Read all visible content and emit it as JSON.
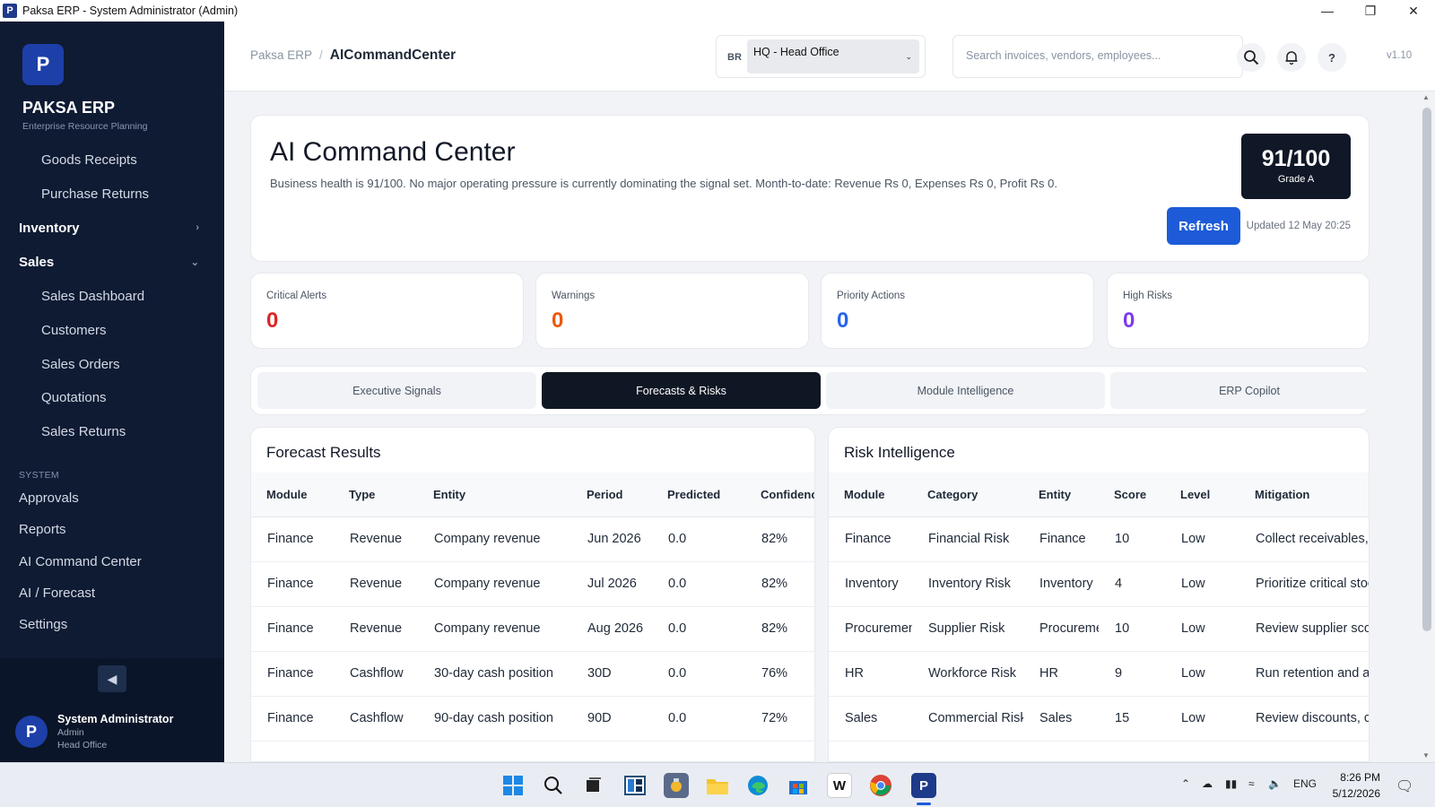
{
  "window": {
    "title": "Paksa ERP - System Administrator (Admin)",
    "app_icon": "P"
  },
  "sidebar": {
    "logo_letter": "P",
    "brand": "PAKSA ERP",
    "brand_sub": "Enterprise Resource Planning",
    "items": [
      {
        "label": "Goods Receipts",
        "kind": "sub"
      },
      {
        "label": "Purchase Returns",
        "kind": "sub"
      },
      {
        "label": "Inventory",
        "kind": "top",
        "chevron": "›"
      },
      {
        "label": "Sales",
        "kind": "top",
        "chevron": "⌄"
      },
      {
        "label": "Sales Dashboard",
        "kind": "sub"
      },
      {
        "label": "Customers",
        "kind": "sub"
      },
      {
        "label": "Sales Orders",
        "kind": "sub"
      },
      {
        "label": "Quotations",
        "kind": "sub"
      },
      {
        "label": "Sales Returns",
        "kind": "sub"
      }
    ],
    "section_label": "SYSTEM",
    "system_items": [
      "Approvals",
      "Reports",
      "AI Command Center",
      "AI / Forecast",
      "Settings"
    ],
    "collapse_icon": "◀",
    "user": {
      "avatar": "P",
      "name": "System Administrator",
      "role": "Admin",
      "branch": "Head Office"
    }
  },
  "header": {
    "breadcrumb_root": "Paksa ERP",
    "breadcrumb_sep": "/",
    "breadcrumb_current": "AICommandCenter",
    "branch_tag": "BR",
    "branch_value": "HQ - Head Office",
    "search_placeholder": "Search invoices, vendors, employees...",
    "help_label": "?",
    "version": "v1.10"
  },
  "hero": {
    "title": "AI Command Center",
    "description": "Business health is 91/100. No major operating pressure is currently dominating the signal set. Month-to-date: Revenue Rs 0, Expenses Rs 0, Profit Rs 0.",
    "score": "91/100",
    "grade": "Grade A",
    "refresh_label": "Refresh",
    "updated": "Updated 12 May 20:25"
  },
  "kpis": [
    {
      "label": "Critical Alerts",
      "value": "0",
      "color": "#dc2626"
    },
    {
      "label": "Warnings",
      "value": "0",
      "color": "#ea580c"
    },
    {
      "label": "Priority Actions",
      "value": "0",
      "color": "#2563eb"
    },
    {
      "label": "High Risks",
      "value": "0",
      "color": "#7c3aed"
    }
  ],
  "tabs": [
    {
      "label": "Executive Signals",
      "active": false
    },
    {
      "label": "Forecasts & Risks",
      "active": true
    },
    {
      "label": "Module Intelligence",
      "active": false
    },
    {
      "label": "ERP Copilot",
      "active": false
    }
  ],
  "forecast": {
    "title": "Forecast Results",
    "columns": [
      "Module",
      "Type",
      "Entity",
      "Period",
      "Predicted",
      "Confidence"
    ],
    "rows": [
      [
        "Finance",
        "Revenue",
        "Company revenue",
        "Jun 2026",
        "0.0",
        "82%"
      ],
      [
        "Finance",
        "Revenue",
        "Company revenue",
        "Jul 2026",
        "0.0",
        "82%"
      ],
      [
        "Finance",
        "Revenue",
        "Company revenue",
        "Aug 2026",
        "0.0",
        "82%"
      ],
      [
        "Finance",
        "Cashflow",
        "30-day cash position",
        "30D",
        "0.0",
        "76%"
      ],
      [
        "Finance",
        "Cashflow",
        "90-day cash position",
        "90D",
        "0.0",
        "72%"
      ]
    ]
  },
  "risk": {
    "title": "Risk Intelligence",
    "columns": [
      "Module",
      "Category",
      "Entity",
      "Score",
      "Level",
      "Mitigation"
    ],
    "rows": [
      [
        "Finance",
        "Financial Risk",
        "Finance",
        "10",
        "Low",
        "Collect receivables, r"
      ],
      [
        "Inventory",
        "Inventory Risk",
        "Inventory",
        "4",
        "Low",
        "Prioritize critical stoc"
      ],
      [
        "Procurement",
        "Supplier Risk",
        "Procurement",
        "10",
        "Low",
        "Review supplier scor"
      ],
      [
        "HR",
        "Workforce Risk",
        "HR",
        "9",
        "Low",
        "Run retention and at"
      ],
      [
        "Sales",
        "Commercial Risk",
        "Sales",
        "15",
        "Low",
        "Review discounts, cre"
      ]
    ]
  },
  "taskbar": {
    "language": "ENG",
    "time": "8:26 PM",
    "date": "5/12/2026"
  }
}
